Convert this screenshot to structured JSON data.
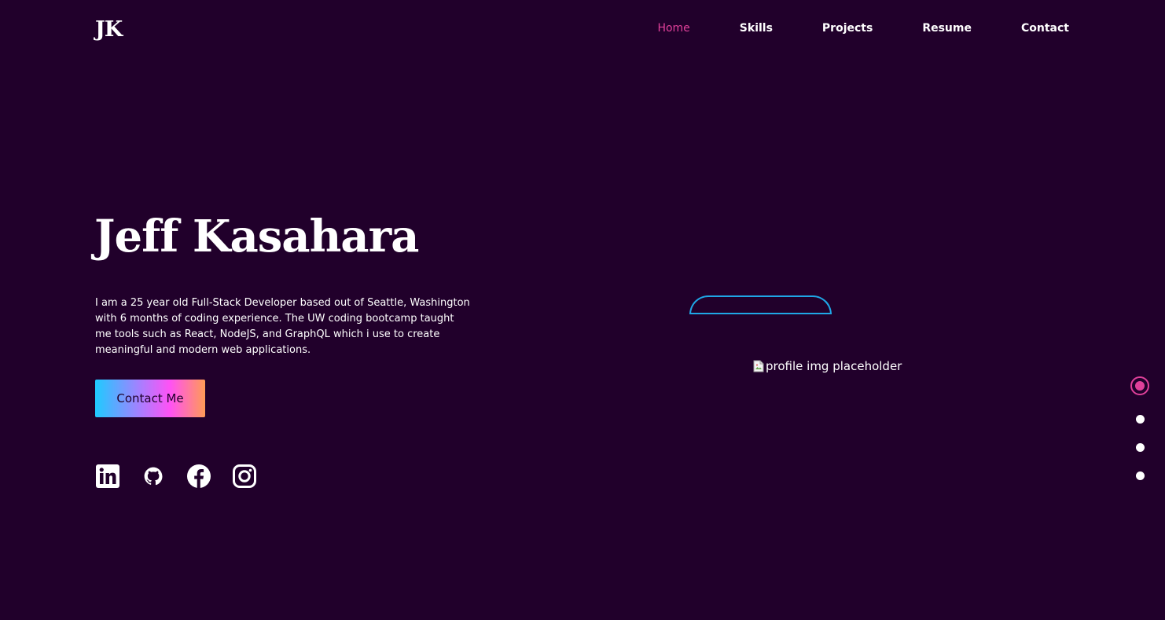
{
  "brand": {
    "logo": "JK"
  },
  "nav": {
    "items": [
      {
        "label": "Home",
        "active": true
      },
      {
        "label": "Skills",
        "active": false
      },
      {
        "label": "Projects",
        "active": false
      },
      {
        "label": "Resume",
        "active": false
      },
      {
        "label": "Contact",
        "active": false
      }
    ],
    "active_color": "#e0409a"
  },
  "hero": {
    "first_name": "Jeff",
    "last_name": "Kasahara",
    "bio": "I am a 25 year old Full-Stack Developer based out of Seattle, Washington with 6 months of coding experience. The UW coding bootcamp taught me tools such as React, NodeJS, and GraphQL which i use to create meaningful and modern web applications.",
    "cta_label": "Contact Me"
  },
  "socials": [
    {
      "icon": "linkedin-icon"
    },
    {
      "icon": "github-icon"
    },
    {
      "icon": "facebook-icon"
    },
    {
      "icon": "instagram-icon"
    }
  ],
  "profile": {
    "alt_text": "profile img placeholder"
  },
  "section_dots": {
    "count": 4,
    "active_index": 0
  },
  "colors": {
    "background": "#21002b",
    "accent": "#e0409a",
    "arc": "#1fa7e6"
  }
}
